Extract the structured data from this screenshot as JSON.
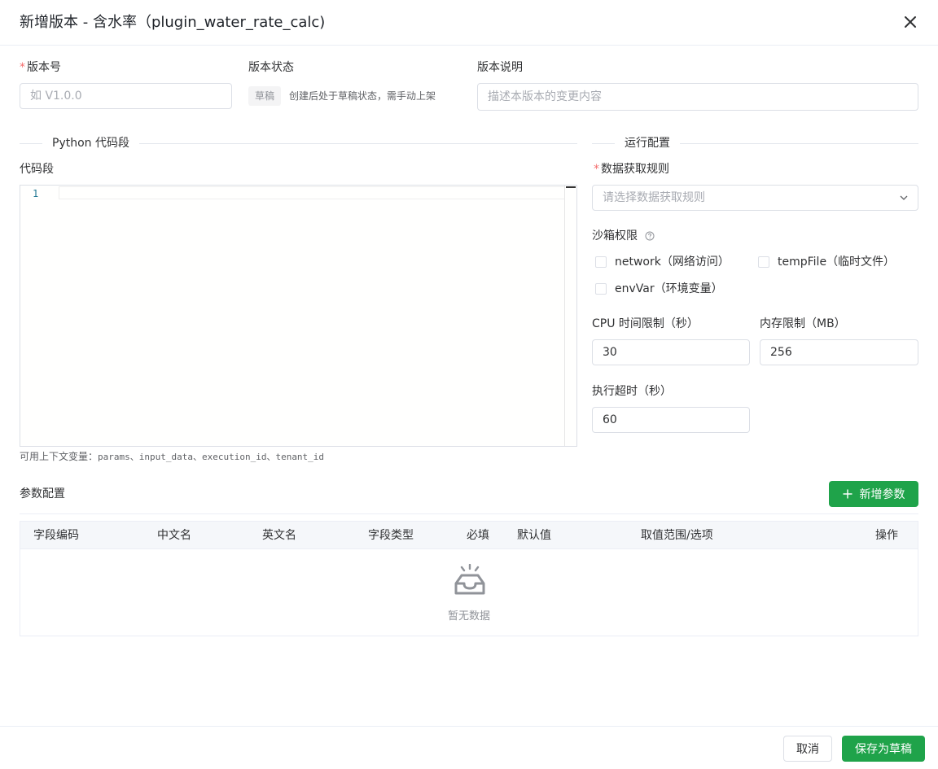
{
  "header": {
    "title": "新增版本 - 含水率（plugin_water_rate_calc)"
  },
  "version_no": {
    "label": "版本号",
    "placeholder": "如 V1.0.0"
  },
  "version_status": {
    "label": "版本状态",
    "tag": "草稿",
    "hint": "创建后处于草稿状态，需手动上架"
  },
  "version_desc": {
    "label": "版本说明",
    "placeholder": "描述本版本的变更内容"
  },
  "code_section": {
    "title": "Python 代码段",
    "field_label": "代码段",
    "line_numbers": [
      "1"
    ],
    "context_hint_prefix": "可用上下文变量：",
    "context_vars": "params、input_data、execution_id、tenant_id"
  },
  "run_config": {
    "title": "运行配置",
    "fetch_rule": {
      "label": "数据获取规则",
      "placeholder": "请选择数据获取规则"
    },
    "sandbox": {
      "label": "沙箱权限",
      "options": [
        {
          "label": "network（网络访问）",
          "checked": false
        },
        {
          "label": "tempFile（临时文件）",
          "checked": false
        },
        {
          "label": "envVar（环境变量）",
          "checked": false
        }
      ]
    },
    "cpu_limit": {
      "label": "CPU 时间限制（秒）",
      "value": "30"
    },
    "memory_limit": {
      "label": "内存限制（MB）",
      "value": "256"
    },
    "timeout": {
      "label": "执行超时（秒）",
      "value": "60"
    }
  },
  "params": {
    "title": "参数配置",
    "add_button": "新增参数",
    "columns": [
      "字段编码",
      "中文名",
      "英文名",
      "字段类型",
      "必填",
      "默认值",
      "取值范围/选项",
      "操作"
    ],
    "rows": [],
    "empty_text": "暂无数据"
  },
  "footer": {
    "cancel": "取消",
    "save_draft": "保存为草稿"
  },
  "colors": {
    "primary": "#1fa34a",
    "required": "#f56c6c",
    "border": "#dcdfe6"
  },
  "icons": {
    "close": "close-icon",
    "chevron": "chevron-down-icon",
    "help": "question-circle-icon",
    "plus": "plus-icon",
    "empty": "empty-inbox-icon"
  }
}
